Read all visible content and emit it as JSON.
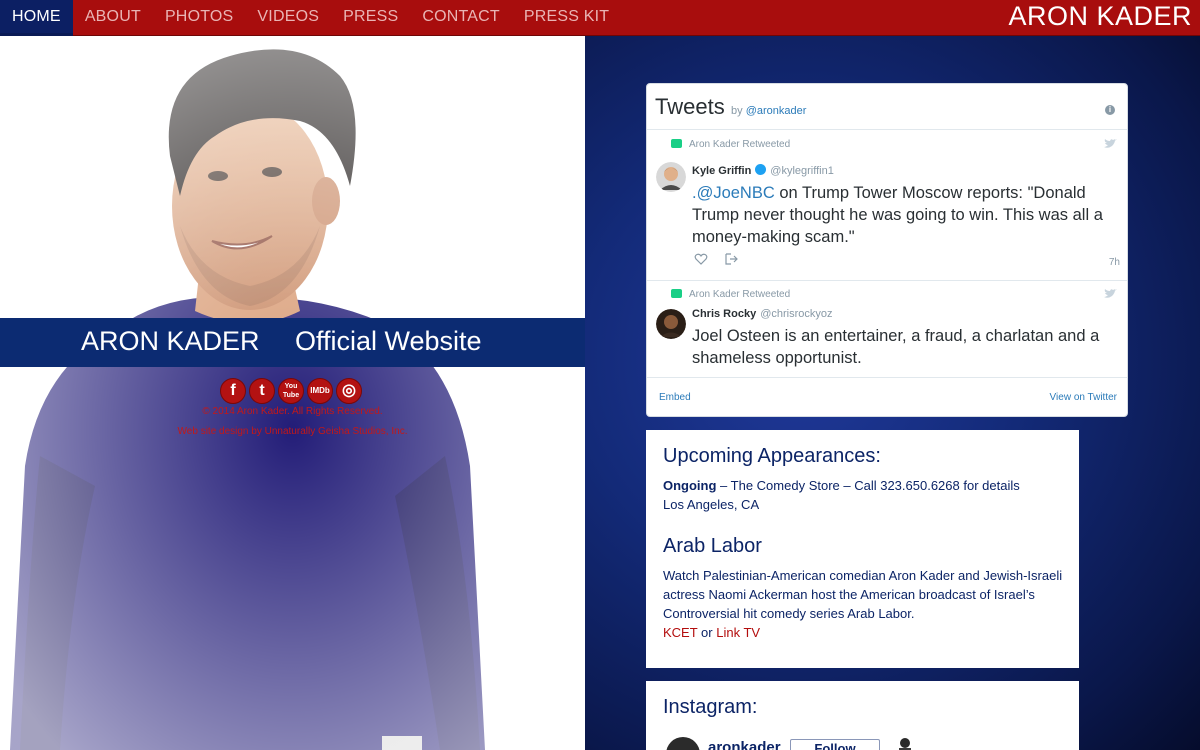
{
  "nav": {
    "items": [
      {
        "label": "HOME",
        "active": true
      },
      {
        "label": "ABOUT"
      },
      {
        "label": "PHOTOS"
      },
      {
        "label": "VIDEOS"
      },
      {
        "label": "PRESS"
      },
      {
        "label": "CONTACT"
      },
      {
        "label": "PRESS KIT"
      }
    ],
    "brand": "ARON KADER"
  },
  "hero": {
    "banner_name": "ARON KADER",
    "banner_subtitle": "Official Website",
    "social": [
      {
        "icon": "facebook-icon",
        "glyph": "f"
      },
      {
        "icon": "twitter-icon",
        "glyph": "t"
      },
      {
        "icon": "youtube-icon",
        "glyph": "You Tube"
      },
      {
        "icon": "imdb-icon",
        "glyph": "IMDb"
      },
      {
        "icon": "instagram-icon",
        "glyph": "◎"
      }
    ],
    "copyright": "© 2014 Aron Kader. All Rights Reserved.",
    "credit": "Web site design by Unnaturally Geisha Studios, Inc."
  },
  "tweets": {
    "title": "Tweets",
    "by": "by",
    "handle": "@aronkader",
    "items": [
      {
        "retweet_label": "Aron Kader Retweeted",
        "name": "Kyle Griffin",
        "screen_name": "@kylegriffin1",
        "mention": ".@JoeNBC",
        "text": " on Trump Tower Moscow reports: \"Donald Trump never thought he was going to win. This was all a money-making scam.\"",
        "time": "7h"
      },
      {
        "retweet_label": "Aron Kader Retweeted",
        "name": "Chris Rocky",
        "screen_name": "@chrisrockyoz",
        "text": "Joel Osteen is an entertainer, a fraud, a charlatan and a shameless opportunist."
      }
    ],
    "embed": "Embed",
    "view_on_twitter": "View on Twitter"
  },
  "appearances": {
    "heading": "Upcoming Appearances:",
    "ongoing_label": "Ongoing",
    "ongoing_text": " – The Comedy Store – Call 323.650.6268 for details",
    "location": "Los Angeles, CA",
    "show_heading": "Arab Labor",
    "show_text": "Watch Palestinian-American comedian Aron Kader and Jewish-Israeli actress Naomi Ackerman host the American broadcast of Israel’s Controversial hit comedy series Arab Labor.",
    "link1": "KCET",
    "or": " or ",
    "link2": "Link TV"
  },
  "instagram": {
    "heading": "Instagram:",
    "username": "aronkader",
    "follow": "Follow"
  },
  "colors": {
    "nav_red": "#a80d0d",
    "nav_active": "#0c1f63",
    "banner_blue": "#0c2b72",
    "text_navy": "#0c2466",
    "link_red": "#b30d0d",
    "twitter_blue": "#2b7bb9"
  }
}
